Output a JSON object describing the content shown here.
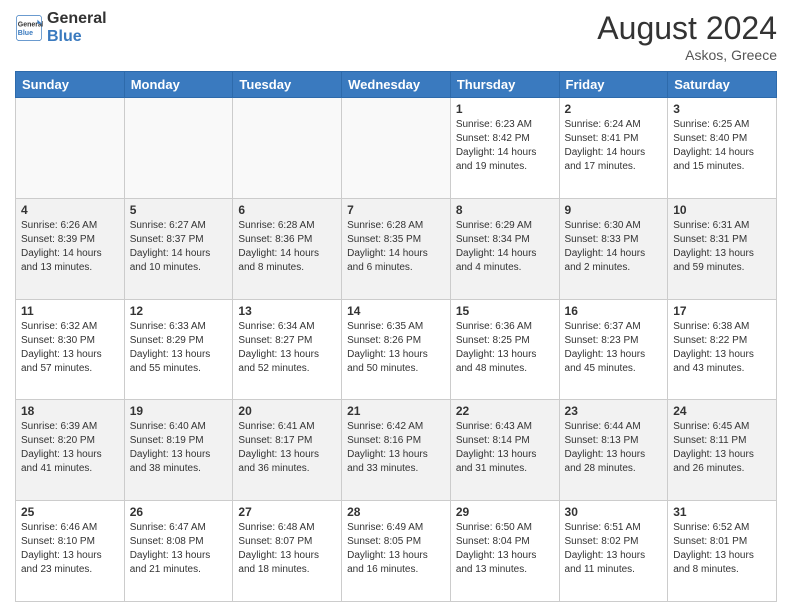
{
  "header": {
    "logo_line1": "General",
    "logo_line2": "Blue",
    "month_year": "August 2024",
    "location": "Askos, Greece"
  },
  "days_of_week": [
    "Sunday",
    "Monday",
    "Tuesday",
    "Wednesday",
    "Thursday",
    "Friday",
    "Saturday"
  ],
  "weeks": [
    [
      {
        "num": "",
        "info": ""
      },
      {
        "num": "",
        "info": ""
      },
      {
        "num": "",
        "info": ""
      },
      {
        "num": "",
        "info": ""
      },
      {
        "num": "1",
        "info": "Sunrise: 6:23 AM\nSunset: 8:42 PM\nDaylight: 14 hours\nand 19 minutes."
      },
      {
        "num": "2",
        "info": "Sunrise: 6:24 AM\nSunset: 8:41 PM\nDaylight: 14 hours\nand 17 minutes."
      },
      {
        "num": "3",
        "info": "Sunrise: 6:25 AM\nSunset: 8:40 PM\nDaylight: 14 hours\nand 15 minutes."
      }
    ],
    [
      {
        "num": "4",
        "info": "Sunrise: 6:26 AM\nSunset: 8:39 PM\nDaylight: 14 hours\nand 13 minutes."
      },
      {
        "num": "5",
        "info": "Sunrise: 6:27 AM\nSunset: 8:37 PM\nDaylight: 14 hours\nand 10 minutes."
      },
      {
        "num": "6",
        "info": "Sunrise: 6:28 AM\nSunset: 8:36 PM\nDaylight: 14 hours\nand 8 minutes."
      },
      {
        "num": "7",
        "info": "Sunrise: 6:28 AM\nSunset: 8:35 PM\nDaylight: 14 hours\nand 6 minutes."
      },
      {
        "num": "8",
        "info": "Sunrise: 6:29 AM\nSunset: 8:34 PM\nDaylight: 14 hours\nand 4 minutes."
      },
      {
        "num": "9",
        "info": "Sunrise: 6:30 AM\nSunset: 8:33 PM\nDaylight: 14 hours\nand 2 minutes."
      },
      {
        "num": "10",
        "info": "Sunrise: 6:31 AM\nSunset: 8:31 PM\nDaylight: 13 hours\nand 59 minutes."
      }
    ],
    [
      {
        "num": "11",
        "info": "Sunrise: 6:32 AM\nSunset: 8:30 PM\nDaylight: 13 hours\nand 57 minutes."
      },
      {
        "num": "12",
        "info": "Sunrise: 6:33 AM\nSunset: 8:29 PM\nDaylight: 13 hours\nand 55 minutes."
      },
      {
        "num": "13",
        "info": "Sunrise: 6:34 AM\nSunset: 8:27 PM\nDaylight: 13 hours\nand 52 minutes."
      },
      {
        "num": "14",
        "info": "Sunrise: 6:35 AM\nSunset: 8:26 PM\nDaylight: 13 hours\nand 50 minutes."
      },
      {
        "num": "15",
        "info": "Sunrise: 6:36 AM\nSunset: 8:25 PM\nDaylight: 13 hours\nand 48 minutes."
      },
      {
        "num": "16",
        "info": "Sunrise: 6:37 AM\nSunset: 8:23 PM\nDaylight: 13 hours\nand 45 minutes."
      },
      {
        "num": "17",
        "info": "Sunrise: 6:38 AM\nSunset: 8:22 PM\nDaylight: 13 hours\nand 43 minutes."
      }
    ],
    [
      {
        "num": "18",
        "info": "Sunrise: 6:39 AM\nSunset: 8:20 PM\nDaylight: 13 hours\nand 41 minutes."
      },
      {
        "num": "19",
        "info": "Sunrise: 6:40 AM\nSunset: 8:19 PM\nDaylight: 13 hours\nand 38 minutes."
      },
      {
        "num": "20",
        "info": "Sunrise: 6:41 AM\nSunset: 8:17 PM\nDaylight: 13 hours\nand 36 minutes."
      },
      {
        "num": "21",
        "info": "Sunrise: 6:42 AM\nSunset: 8:16 PM\nDaylight: 13 hours\nand 33 minutes."
      },
      {
        "num": "22",
        "info": "Sunrise: 6:43 AM\nSunset: 8:14 PM\nDaylight: 13 hours\nand 31 minutes."
      },
      {
        "num": "23",
        "info": "Sunrise: 6:44 AM\nSunset: 8:13 PM\nDaylight: 13 hours\nand 28 minutes."
      },
      {
        "num": "24",
        "info": "Sunrise: 6:45 AM\nSunset: 8:11 PM\nDaylight: 13 hours\nand 26 minutes."
      }
    ],
    [
      {
        "num": "25",
        "info": "Sunrise: 6:46 AM\nSunset: 8:10 PM\nDaylight: 13 hours\nand 23 minutes."
      },
      {
        "num": "26",
        "info": "Sunrise: 6:47 AM\nSunset: 8:08 PM\nDaylight: 13 hours\nand 21 minutes."
      },
      {
        "num": "27",
        "info": "Sunrise: 6:48 AM\nSunset: 8:07 PM\nDaylight: 13 hours\nand 18 minutes."
      },
      {
        "num": "28",
        "info": "Sunrise: 6:49 AM\nSunset: 8:05 PM\nDaylight: 13 hours\nand 16 minutes."
      },
      {
        "num": "29",
        "info": "Sunrise: 6:50 AM\nSunset: 8:04 PM\nDaylight: 13 hours\nand 13 minutes."
      },
      {
        "num": "30",
        "info": "Sunrise: 6:51 AM\nSunset: 8:02 PM\nDaylight: 13 hours\nand 11 minutes."
      },
      {
        "num": "31",
        "info": "Sunrise: 6:52 AM\nSunset: 8:01 PM\nDaylight: 13 hours\nand 8 minutes."
      }
    ]
  ]
}
